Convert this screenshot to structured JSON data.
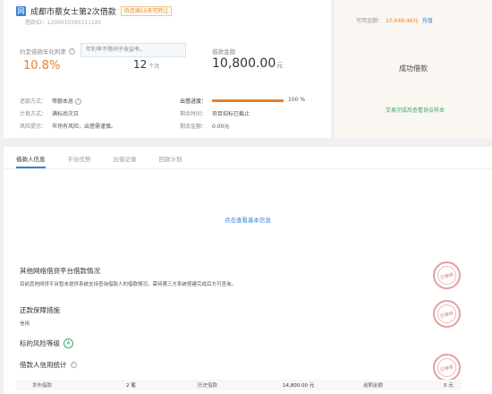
{
  "loan": {
    "type_icon": "网",
    "title": "成都市蔡女士第2次借款",
    "tag": "待还满10天可转让",
    "id_label": "借款ID：",
    "id_value": "1200010395511181",
    "rate_label": "约定借款年化利率",
    "rate_value": "10.8%",
    "tooltip": "年利率不等同于收益率。",
    "term_value": "12",
    "term_unit": "个月",
    "amount_label": "借款金额",
    "amount_value": "10,800.00",
    "amount_unit": "元",
    "repay_label": "还款方式：",
    "repay_value": "等额本息",
    "interest_label": "计息方式：",
    "interest_value": "满标后次日",
    "risk_label": "风险提示：",
    "risk_value": "市场有风险，出借需谨慎。",
    "progress_label": "出借进度：",
    "progress_pct": "100 %",
    "progress_fraction": 1.0,
    "remaining_time_label": "剩余时间：",
    "remaining_time_value": "项目招标已截止",
    "remaining_amount_label": "剩余金额：",
    "remaining_amount_value": "0.00元"
  },
  "side": {
    "available_label": "可用金额：",
    "available_value": "10,649.46元",
    "recharge_link": "充值",
    "status": "成功借款",
    "contract_link": "交易完成后查看协议样本"
  },
  "tabs": [
    "借款人信息",
    "平台优势",
    "出借记录",
    "回款计划"
  ],
  "basic_info_link": "点击查看基本信息",
  "sections": {
    "other_platform_title": "其他网络借贷平台借款情况",
    "other_platform_desc": "目前其他网贷平台暂未提供系统支持查询借款人的借款情况，需待第三方系统搭建完成后方可查询。",
    "guarantee_title": "还款保障措施",
    "guarantee_value": "信用",
    "risk_level_title": "标的风险等级",
    "risk_level_value": "A",
    "credit_title": "借款人信用统计",
    "seal_text": "已审核"
  },
  "stats": [
    {
      "label": "发布借款",
      "value": "2 笔"
    },
    {
      "label": "历史借款",
      "value": "14,800.00 元"
    },
    {
      "label": "逾期金额",
      "value": "0 元"
    }
  ]
}
